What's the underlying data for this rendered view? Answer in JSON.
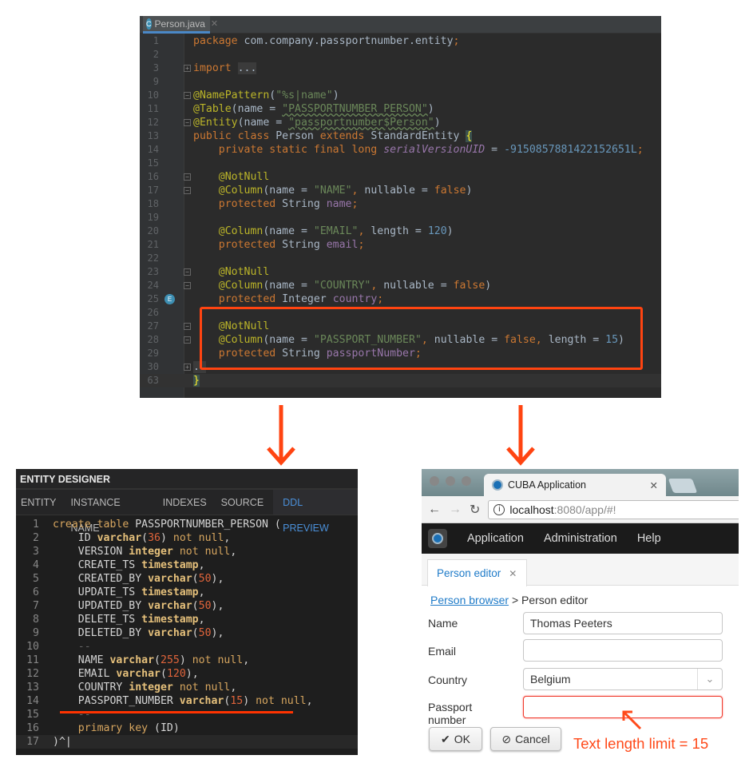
{
  "ide": {
    "tab": {
      "label": "Person.java",
      "icon": "class-icon",
      "icon_letter": "C"
    },
    "lines": [
      {
        "n": "1",
        "t": [
          [
            "kw",
            "package "
          ],
          [
            "pl",
            "com.company.passportnumber.entity"
          ],
          [
            "kw",
            ";"
          ]
        ]
      },
      {
        "n": "2",
        "t": []
      },
      {
        "n": "3",
        "fold": "+",
        "t": [
          [
            "kw",
            "import "
          ],
          [
            "fold",
            "..."
          ]
        ]
      },
      {
        "n": "9",
        "t": []
      },
      {
        "n": "10",
        "fold": "-",
        "t": [
          [
            "ann",
            "@NamePattern"
          ],
          [
            "pl",
            "("
          ],
          [
            "str",
            "\"%s|name\""
          ],
          [
            "pl",
            ")"
          ]
        ]
      },
      {
        "n": "11",
        "t": [
          [
            "ann",
            "@Table"
          ],
          [
            "pl",
            "(name = "
          ],
          [
            "str",
            "\"PASSPORTNUMBER_PERSON\""
          ],
          [
            "pl",
            ")"
          ]
        ]
      },
      {
        "n": "12",
        "fold": "-",
        "t": [
          [
            "ann",
            "@Entity"
          ],
          [
            "pl",
            "(name = "
          ],
          [
            "str",
            "\"passportnumber$Person\""
          ],
          [
            "pl",
            ")"
          ]
        ]
      },
      {
        "n": "13",
        "t": [
          [
            "kw",
            "public class "
          ],
          [
            "pl",
            "Person "
          ],
          [
            "kw",
            "extends "
          ],
          [
            "pl",
            "StandardEntity "
          ],
          [
            "brace",
            "{"
          ]
        ]
      },
      {
        "n": "14",
        "t": [
          [
            "kw",
            "    private static final long "
          ],
          [
            "ital",
            "serialVersionUID"
          ],
          [
            "pl",
            " = "
          ],
          [
            "num",
            "-9150857881422152651L"
          ],
          [
            "kw",
            ";"
          ]
        ]
      },
      {
        "n": "15",
        "t": []
      },
      {
        "n": "16",
        "fold": "-",
        "t": [
          [
            "ann",
            "    @NotNull"
          ]
        ]
      },
      {
        "n": "17",
        "fold": "-",
        "t": [
          [
            "ann",
            "    @Column"
          ],
          [
            "pl",
            "(name = "
          ],
          [
            "str",
            "\"NAME\""
          ],
          [
            "kw",
            ", "
          ],
          [
            "pl",
            "nullable = "
          ],
          [
            "kw",
            "false"
          ],
          [
            "pl",
            ")"
          ]
        ]
      },
      {
        "n": "18",
        "t": [
          [
            "kw",
            "    protected "
          ],
          [
            "pl",
            "String "
          ],
          [
            "fld",
            "name"
          ],
          [
            "kw",
            ";"
          ]
        ]
      },
      {
        "n": "19",
        "t": []
      },
      {
        "n": "20",
        "t": [
          [
            "ann",
            "    @Column"
          ],
          [
            "pl",
            "(name = "
          ],
          [
            "str",
            "\"EMAIL\""
          ],
          [
            "kw",
            ", "
          ],
          [
            "pl",
            "length = "
          ],
          [
            "num",
            "120"
          ],
          [
            "pl",
            ")"
          ]
        ]
      },
      {
        "n": "21",
        "t": [
          [
            "kw",
            "    protected "
          ],
          [
            "pl",
            "String "
          ],
          [
            "fld",
            "email"
          ],
          [
            "kw",
            ";"
          ]
        ]
      },
      {
        "n": "22",
        "t": []
      },
      {
        "n": "23",
        "fold": "-",
        "t": [
          [
            "ann",
            "    @NotNull"
          ]
        ]
      },
      {
        "n": "24",
        "fold": "-",
        "t": [
          [
            "ann",
            "    @Column"
          ],
          [
            "pl",
            "(name = "
          ],
          [
            "str",
            "\"COUNTRY\""
          ],
          [
            "kw",
            ", "
          ],
          [
            "pl",
            "nullable = "
          ],
          [
            "kw",
            "false"
          ],
          [
            "pl",
            ")"
          ]
        ]
      },
      {
        "n": "25",
        "badge": "E",
        "t": [
          [
            "kw",
            "    protected "
          ],
          [
            "pl",
            "Integer "
          ],
          [
            "fld",
            "country"
          ],
          [
            "kw",
            ";"
          ]
        ]
      },
      {
        "n": "26",
        "t": []
      },
      {
        "n": "27",
        "fold": "-",
        "t": [
          [
            "ann",
            "    @NotNull"
          ]
        ]
      },
      {
        "n": "28",
        "fold": "-",
        "t": [
          [
            "ann",
            "    @Column"
          ],
          [
            "pl",
            "(name = "
          ],
          [
            "str",
            "\"PASSPORT_NUMBER\""
          ],
          [
            "kw",
            ", "
          ],
          [
            "pl",
            "nullable = "
          ],
          [
            "kw",
            "false"
          ],
          [
            "kw",
            ", "
          ],
          [
            "pl",
            "length = "
          ],
          [
            "num",
            "15"
          ],
          [
            "pl",
            ")"
          ]
        ]
      },
      {
        "n": "29",
        "t": [
          [
            "kw",
            "    protected "
          ],
          [
            "pl",
            "String "
          ],
          [
            "fld",
            "passportNumber"
          ],
          [
            "kw",
            ";"
          ]
        ]
      },
      {
        "n": "30",
        "fold": "+",
        "t": [
          [
            "fold",
            ".."
          ]
        ]
      },
      {
        "n": "63",
        "cur": true,
        "t": [
          [
            "brace",
            "}"
          ]
        ]
      }
    ]
  },
  "entity_designer": {
    "title": "ENTITY DESIGNER",
    "tabs": [
      "ENTITY",
      "INSTANCE NAME",
      "INDEXES",
      "SOURCE",
      "DDL PREVIEW"
    ],
    "active_tab": "DDL PREVIEW",
    "lines": [
      {
        "n": "1",
        "t": [
          [
            "kw",
            "create table "
          ],
          [
            "pl",
            "PASSPORTNUMBER_PERSON ("
          ]
        ]
      },
      {
        "n": "2",
        "t": [
          [
            "pl",
            "    ID "
          ],
          [
            "ty",
            "varchar"
          ],
          [
            "pl",
            "("
          ],
          [
            "num",
            "36"
          ],
          [
            "pl",
            ") "
          ],
          [
            "kw",
            "not null"
          ],
          [
            "pl",
            ","
          ]
        ]
      },
      {
        "n": "3",
        "t": [
          [
            "pl",
            "    VERSION "
          ],
          [
            "ty",
            "integer "
          ],
          [
            "kw",
            "not null"
          ],
          [
            "pl",
            ","
          ]
        ]
      },
      {
        "n": "4",
        "t": [
          [
            "pl",
            "    CREATE_TS "
          ],
          [
            "ty",
            "timestamp"
          ],
          [
            "pl",
            ","
          ]
        ]
      },
      {
        "n": "5",
        "t": [
          [
            "pl",
            "    CREATED_BY "
          ],
          [
            "ty",
            "varchar"
          ],
          [
            "pl",
            "("
          ],
          [
            "num",
            "50"
          ],
          [
            "pl",
            "),"
          ]
        ]
      },
      {
        "n": "6",
        "t": [
          [
            "pl",
            "    UPDATE_TS "
          ],
          [
            "ty",
            "timestamp"
          ],
          [
            "pl",
            ","
          ]
        ]
      },
      {
        "n": "7",
        "t": [
          [
            "pl",
            "    UPDATED_BY "
          ],
          [
            "ty",
            "varchar"
          ],
          [
            "pl",
            "("
          ],
          [
            "num",
            "50"
          ],
          [
            "pl",
            "),"
          ]
        ]
      },
      {
        "n": "8",
        "t": [
          [
            "pl",
            "    DELETE_TS "
          ],
          [
            "ty",
            "timestamp"
          ],
          [
            "pl",
            ","
          ]
        ]
      },
      {
        "n": "9",
        "t": [
          [
            "pl",
            "    DELETED_BY "
          ],
          [
            "ty",
            "varchar"
          ],
          [
            "pl",
            "("
          ],
          [
            "num",
            "50"
          ],
          [
            "pl",
            "),"
          ]
        ]
      },
      {
        "n": "10",
        "t": [
          [
            "cm",
            "    --"
          ]
        ]
      },
      {
        "n": "11",
        "t": [
          [
            "pl",
            "    NAME "
          ],
          [
            "ty",
            "varchar"
          ],
          [
            "pl",
            "("
          ],
          [
            "num",
            "255"
          ],
          [
            "pl",
            ") "
          ],
          [
            "kw",
            "not null"
          ],
          [
            "pl",
            ","
          ]
        ]
      },
      {
        "n": "12",
        "t": [
          [
            "pl",
            "    EMAIL "
          ],
          [
            "ty",
            "varchar"
          ],
          [
            "pl",
            "("
          ],
          [
            "num",
            "120"
          ],
          [
            "pl",
            "),"
          ]
        ]
      },
      {
        "n": "13",
        "t": [
          [
            "pl",
            "    COUNTRY "
          ],
          [
            "ty",
            "integer "
          ],
          [
            "kw",
            "not null"
          ],
          [
            "pl",
            ","
          ]
        ]
      },
      {
        "n": "14",
        "t": [
          [
            "pl",
            "    PASSPORT_NUMBER "
          ],
          [
            "ty",
            "varchar"
          ],
          [
            "pl",
            "("
          ],
          [
            "num",
            "15"
          ],
          [
            "pl",
            ") "
          ],
          [
            "kw",
            "not null"
          ],
          [
            "pl",
            ","
          ]
        ]
      },
      {
        "n": "15",
        "t": [
          [
            "cm",
            "    --"
          ]
        ]
      },
      {
        "n": "16",
        "t": [
          [
            "kw",
            "    primary key "
          ],
          [
            "pl",
            "(ID)"
          ]
        ]
      },
      {
        "n": "17",
        "cur": true,
        "t": [
          [
            "pl",
            ")^|"
          ]
        ]
      }
    ]
  },
  "browser": {
    "tab_title": "CUBA Application",
    "url_host": "localhost",
    "url_rest": ":8080/app/#!",
    "menu": [
      "Application",
      "Administration",
      "Help"
    ],
    "window_tab": "Person editor",
    "breadcrumb": {
      "link": "Person browser",
      "sep": ">",
      "current": "Person editor"
    },
    "form": {
      "name_label": "Name",
      "name_value": "Thomas Peeters",
      "email_label": "Email",
      "email_value": "",
      "country_label": "Country",
      "country_value": "Belgium",
      "passport_label": "Passport number",
      "passport_value": ""
    },
    "ok": "OK",
    "cancel": "Cancel"
  },
  "annotation": {
    "text": "Text length limit = 15",
    "color": "#ff4a1a"
  },
  "colors": {
    "highlight": "#ff4411",
    "link": "#1f7bc8",
    "error_border": "#ef3a2b"
  }
}
